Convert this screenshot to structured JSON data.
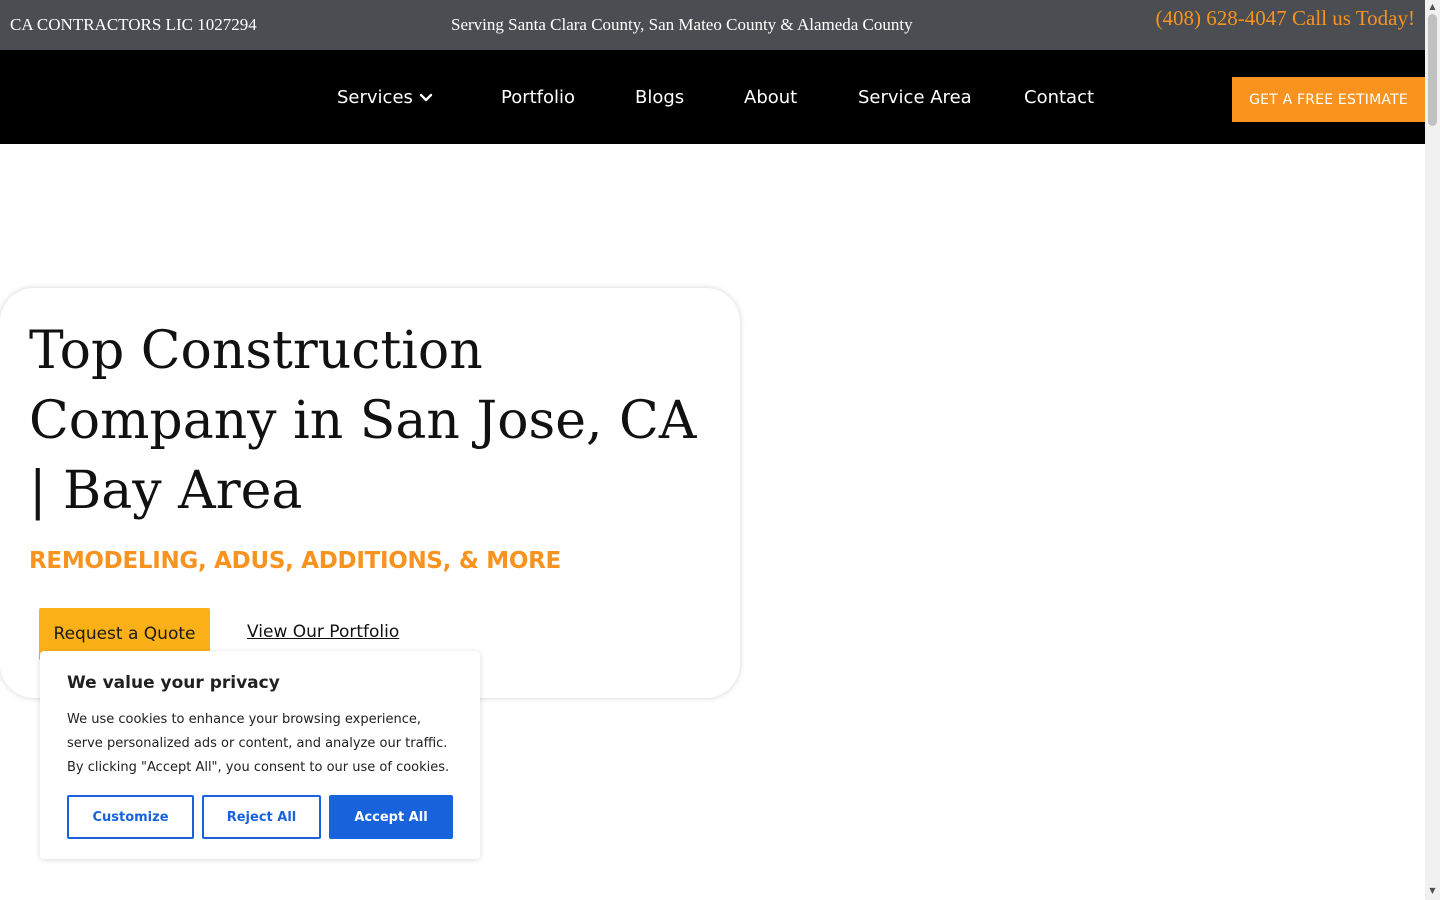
{
  "topbar": {
    "license": "CA CONTRACTORS LIC 1027294",
    "serving": "Serving Santa Clara County, San Mateo County & Alameda County",
    "phone": "(408) 628-4047 Call us Today!"
  },
  "nav": {
    "items": [
      {
        "label": "Services"
      },
      {
        "label": "Portfolio"
      },
      {
        "label": "Blogs"
      },
      {
        "label": "About"
      },
      {
        "label": "Service Area"
      },
      {
        "label": "Contact"
      }
    ],
    "cta_label": "GET A FREE ESTIMATE"
  },
  "hero": {
    "title": "Top Construction Company in San Jose, CA | Bay Area",
    "subtitle": "REMODELING, ADUS, ADDITIONS, & MORE",
    "quote_button": "Request a Quote",
    "portfolio_link": "View Our Portfolio"
  },
  "cookie": {
    "title": "We value your privacy",
    "text": "We use cookies to enhance your browsing experience, serve personalized ads or content, and analyze our traffic. By clicking \"Accept All\", you consent to our use of cookies.",
    "customize": "Customize",
    "reject": "Reject All",
    "accept": "Accept All"
  },
  "colors": {
    "accent_orange": "#f7931e",
    "quote_yellow": "#fbb017",
    "cookie_blue": "#1863dc",
    "topbar_gray": "#4a4d52",
    "nav_black": "#000000"
  },
  "icons": {
    "services_dropdown": "chevron-down-icon",
    "scroll_up": "scroll-up-arrow-icon",
    "scroll_down": "scroll-down-arrow-icon"
  }
}
